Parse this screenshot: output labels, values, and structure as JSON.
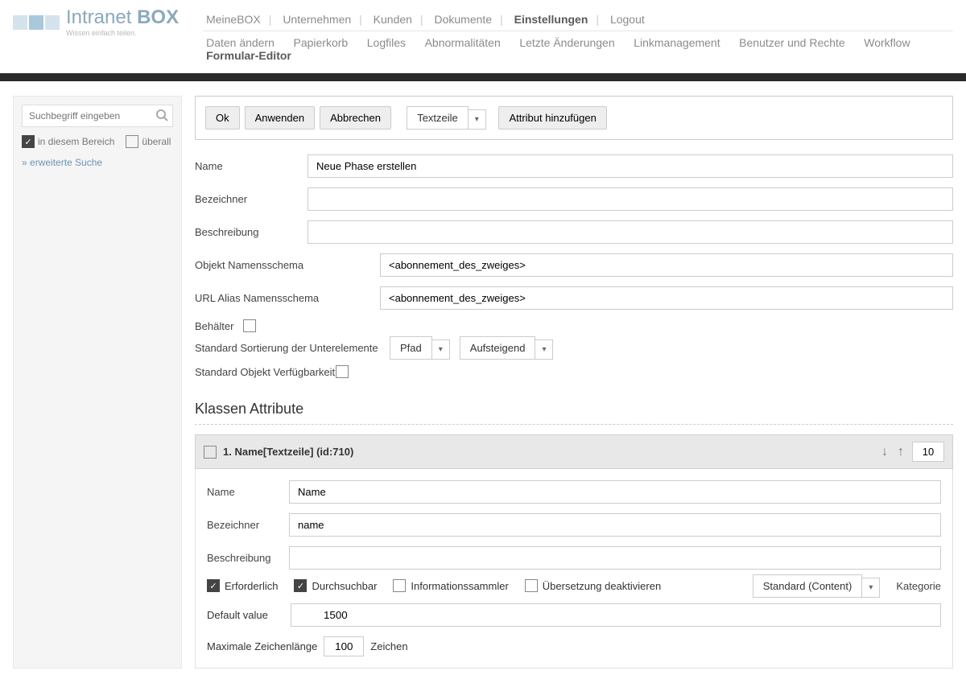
{
  "logo": {
    "name": "Intranet",
    "bold": "BOX",
    "tagline": "Wissen einfach teilen."
  },
  "topnav": {
    "items": [
      "MeineBOX",
      "Unternehmen",
      "Kunden",
      "Dokumente",
      "Einstellungen",
      "Logout"
    ],
    "active": "Einstellungen"
  },
  "subnav": {
    "items": [
      "Daten ändern",
      "Papierkorb",
      "Logfiles",
      "Abnormalitäten",
      "Letzte Änderungen",
      "Linkmanagement",
      "Benutzer und Rechte",
      "Workflow",
      "Formular-Editor"
    ],
    "active": "Formular-Editor"
  },
  "search": {
    "placeholder": "Suchbegriff eingeben",
    "scope_here": "in diesem Bereich",
    "scope_all": "überall",
    "advanced": "erweiterte Suche"
  },
  "toolbar": {
    "ok": "Ok",
    "apply": "Anwenden",
    "cancel": "Abbrechen",
    "type_select": "Textzeile",
    "add_attr": "Attribut hinzufügen"
  },
  "form": {
    "name_label": "Name",
    "name_value": "Neue Phase erstellen",
    "ident_label": "Bezeichner",
    "ident_value": "",
    "desc_label": "Beschreibung",
    "desc_value": "",
    "obj_schema_label": "Objekt Namensschema",
    "obj_schema_value": "<abonnement_des_zweiges>",
    "url_schema_label": "URL Alias Namensschema",
    "url_schema_value": "<abonnement_des_zweiges>",
    "container_label": "Behälter",
    "sort_label": "Standard Sortierung der Unterelemente",
    "sort_field": "Pfad",
    "sort_dir": "Aufsteigend",
    "avail_label": "Standard Objekt Verfügbarkeit"
  },
  "section": {
    "title": "Klassen Attribute"
  },
  "attr": {
    "header": "1. Name[Textzeile] (id:710)",
    "order": "10",
    "name_label": "Name",
    "name_value": "Name",
    "ident_label": "Bezeichner",
    "ident_value": "name",
    "desc_label": "Beschreibung",
    "desc_value": "",
    "required": "Erforderlich",
    "searchable": "Durchsuchbar",
    "collector": "Informationssammler",
    "no_translate": "Übersetzung deaktivieren",
    "category_select": "Standard (Content)",
    "category_label": "Kategorie",
    "default_label": "Default value",
    "default_value": "1500",
    "maxlen_label": "Maximale Zeichenlänge",
    "maxlen_value": "100",
    "maxlen_unit": "Zeichen"
  }
}
